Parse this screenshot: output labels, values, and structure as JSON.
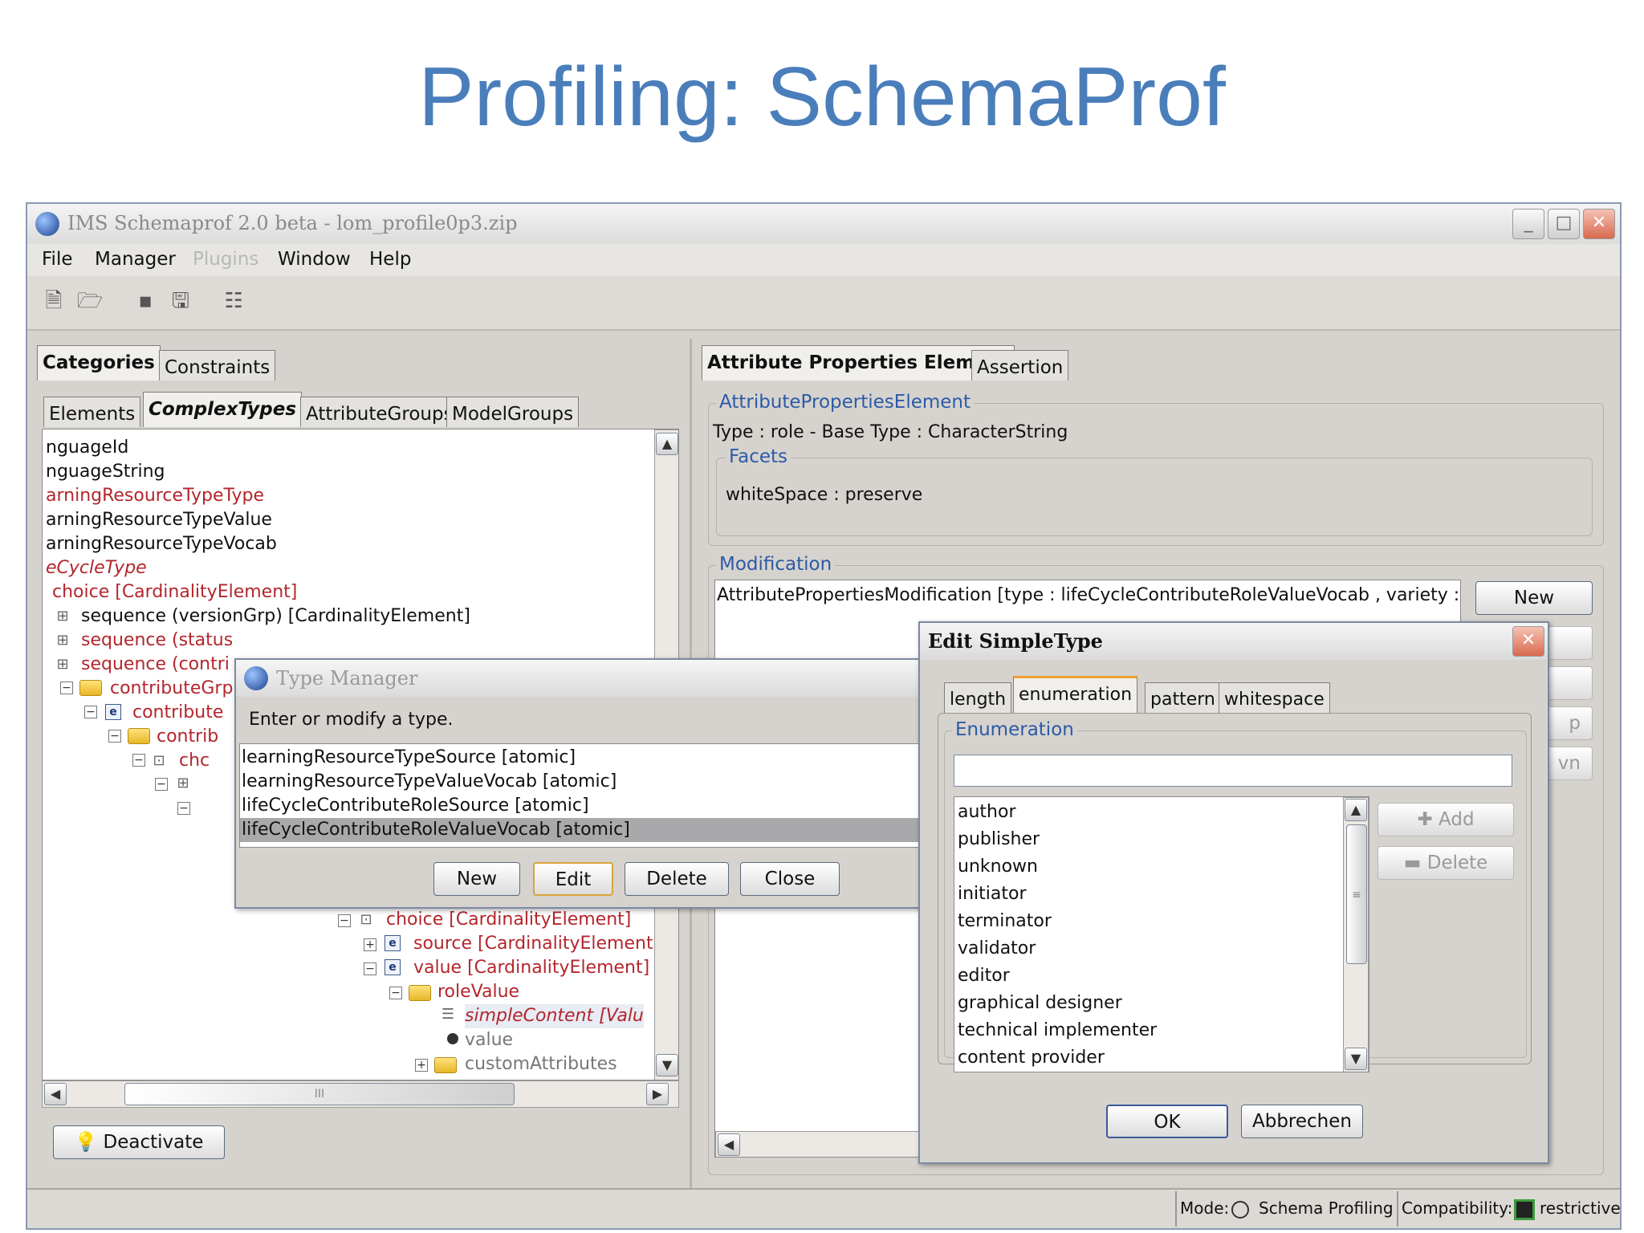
{
  "slide": {
    "title": "Profiling: SchemaProf"
  },
  "window": {
    "title": "IMS Schemaprof 2.0 beta - lom_profile0p3.zip",
    "menu": [
      "File",
      "Manager",
      "Plugins",
      "Window",
      "Help"
    ],
    "menu_disabled": "Plugins",
    "minimize": "_",
    "maximize": "□",
    "close": "✕"
  },
  "toolbar": {
    "icons": [
      "new-document-icon",
      "open-folder-icon",
      "save-icon",
      "save-all-icon",
      "tree-view-icon"
    ],
    "glyphs": [
      "🗎",
      "🗁",
      "▪",
      "🖫",
      "☷"
    ]
  },
  "left": {
    "outer_tabs": [
      "Categories",
      "Constraints"
    ],
    "inner_tabs": [
      "Elements",
      "ComplexTypes",
      "AttributeGroups",
      "ModelGroups"
    ],
    "tree_rows": [
      {
        "text": "nguageId",
        "style": "black"
      },
      {
        "text": "nguageString",
        "style": "black"
      },
      {
        "text": "arningResourceTypeType",
        "style": "red"
      },
      {
        "text": "arningResourceTypeValue",
        "style": "black"
      },
      {
        "text": "arningResourceTypeVocab",
        "style": "black"
      },
      {
        "text": "eCycleType",
        "style": "redit"
      },
      {
        "text": "choice [CardinalityElement]",
        "style": "red"
      },
      {
        "text": "sequence (versionGrp) [CardinalityElement]",
        "style": "black"
      },
      {
        "text": "sequence (status",
        "style": "red"
      },
      {
        "text": "sequence (contri",
        "style": "red"
      },
      {
        "text": "contributeGrp",
        "style": "red"
      },
      {
        "text": "contribute",
        "style": "red"
      },
      {
        "text": "contrib",
        "style": "red"
      },
      {
        "text": "chc",
        "style": "red"
      }
    ],
    "tree_rows_lower": [
      {
        "text": "choice [CardinalityElement]",
        "style": "red"
      },
      {
        "text": "source [CardinalityElement]",
        "style": "red"
      },
      {
        "text": "value [CardinalityElement]",
        "style": "red"
      },
      {
        "text": "roleValue",
        "style": "red"
      },
      {
        "text": "simpleContent [Valu",
        "style": "redit"
      },
      {
        "text": "value",
        "style": "gray"
      },
      {
        "text": "customAttributes",
        "style": "gray"
      }
    ],
    "deactivate": "Deactivate",
    "hscroll_grip": "III"
  },
  "right": {
    "tabs": [
      "Attribute Properties Element",
      "Assertion"
    ],
    "ape_label": "AttributePropertiesElement",
    "type_line": "Type  :  role  -  Base Type  :  CharacterString",
    "facets_label": "Facets",
    "facet_line": "whiteSpace  :  preserve",
    "modification_label": "Modification",
    "modification_item": "AttributePropertiesModification [type : lifeCycleContributeRoleValueVocab , variety : a",
    "new_button": "New",
    "partial_buttons": [
      "p",
      "vn"
    ]
  },
  "type_manager": {
    "title": "Type Manager",
    "prompt": "Enter or modify a type.",
    "items": [
      "learningResourceTypeSource [atomic]",
      "learningResourceTypeValueVocab [atomic]",
      "lifeCycleContributeRoleSource [atomic]",
      "lifeCycleContributeRoleValueVocab [atomic]"
    ],
    "selected_index": 3,
    "buttons": [
      "New",
      "Edit",
      "Delete",
      "Close"
    ]
  },
  "edit_simple": {
    "title": "Edit SimpleType",
    "tabs": [
      "length",
      "enumeration",
      "pattern",
      "whitespace"
    ],
    "selected_tab": "enumeration",
    "enum_label": "Enumeration",
    "input_value": "",
    "values": [
      "author",
      "publisher",
      "unknown",
      "initiator",
      "terminator",
      "validator",
      "editor",
      "graphical designer",
      "technical implementer",
      "content provider"
    ],
    "add": "Add",
    "delete": "Delete",
    "ok": "OK",
    "cancel": "Abbrechen",
    "scroll_grip": "≡"
  },
  "statusbar": {
    "mode_label": "Mode:",
    "mode_value": "Schema Profiling",
    "compat_label": "Compatibility:",
    "compat_value": "restrictive"
  },
  "colors": {
    "title_blue": "#4a7ebb",
    "tree_red": "#b3262d",
    "group_blue": "#2c5aa6",
    "panel_gray": "#d6d3ce",
    "selection": "#a9a9ab"
  }
}
